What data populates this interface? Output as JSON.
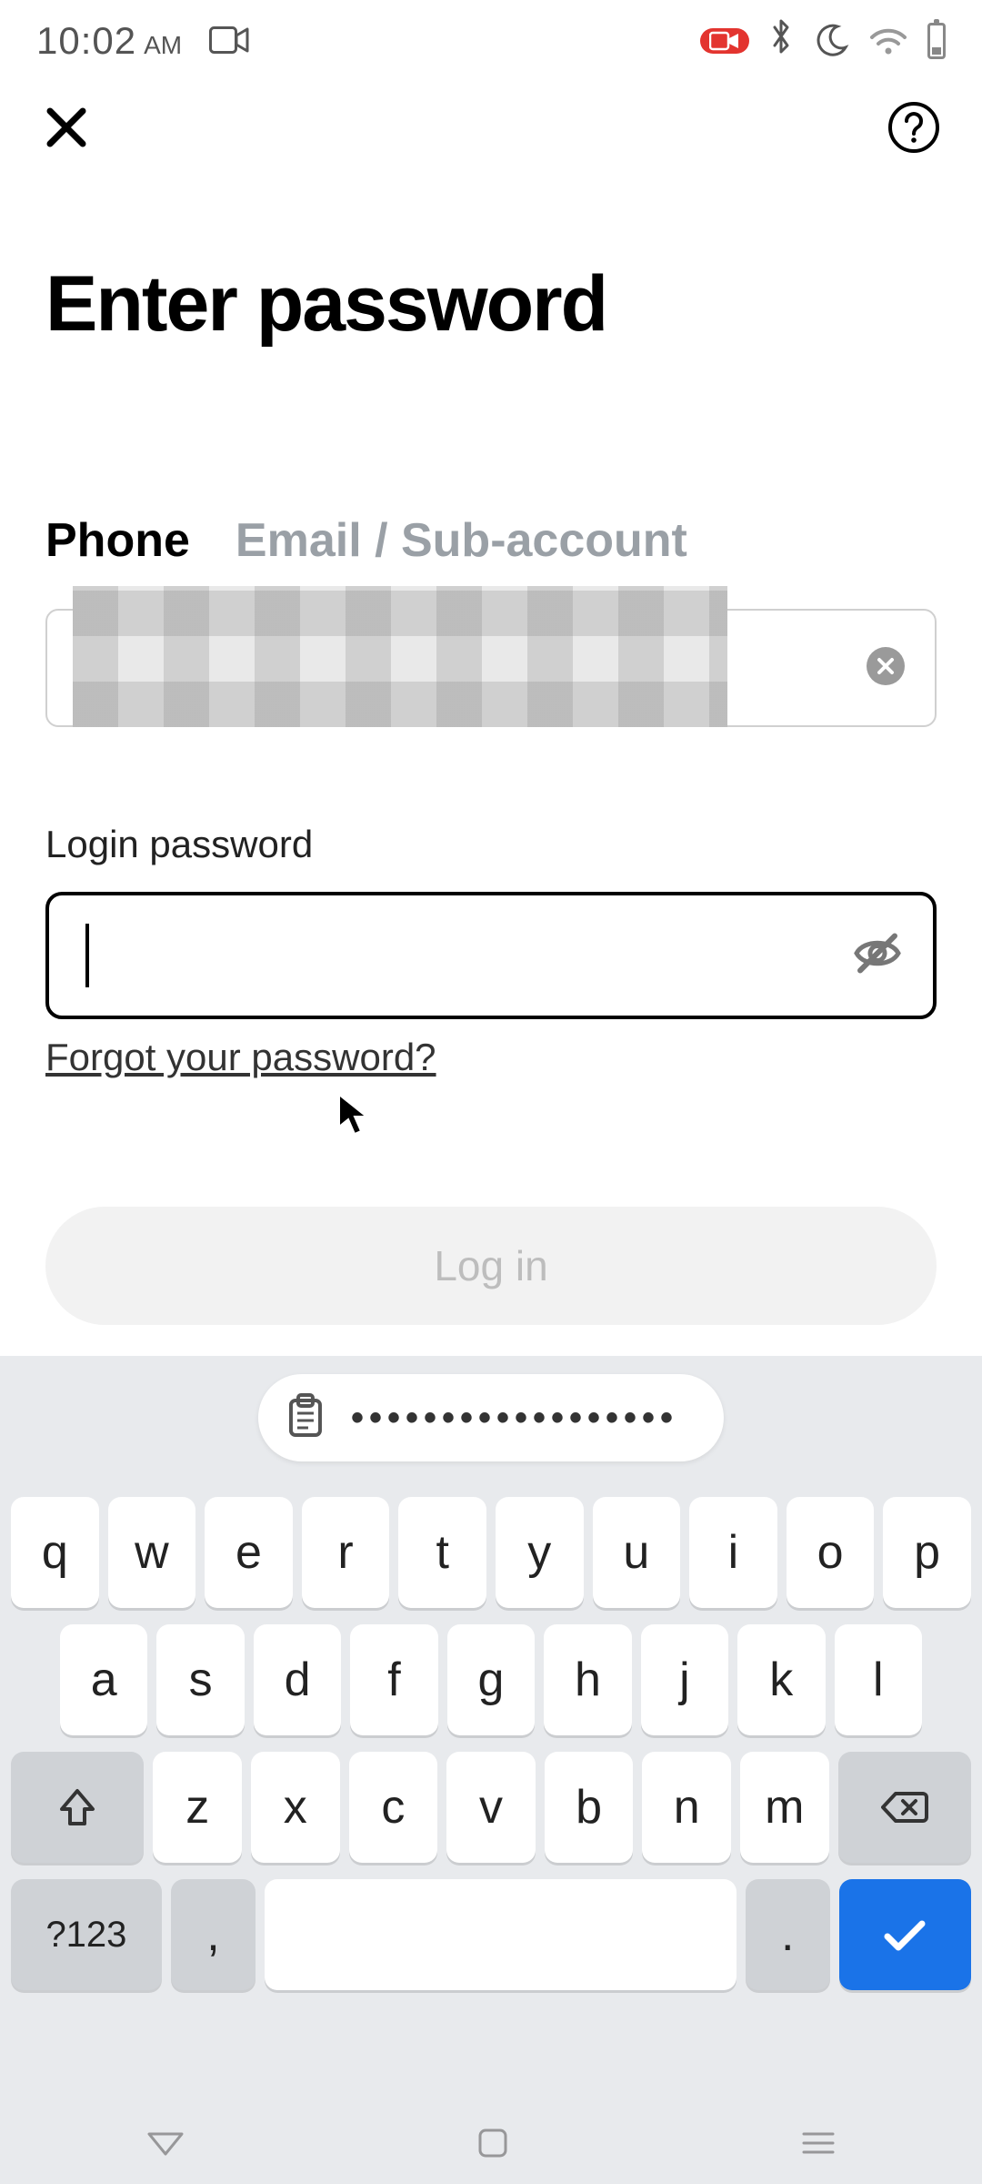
{
  "status": {
    "time": "10:02",
    "am": "AM"
  },
  "page": {
    "title": "Enter password",
    "tab_phone": "Phone",
    "tab_email": "Email / Sub-account",
    "password_label": "Login password",
    "forgot": "Forgot your password?",
    "login": "Log in"
  },
  "suggestion": {
    "dots": "••••••••••••••••••"
  },
  "keyboard": {
    "row1": [
      "q",
      "w",
      "e",
      "r",
      "t",
      "y",
      "u",
      "i",
      "o",
      "p"
    ],
    "row2": [
      "a",
      "s",
      "d",
      "f",
      "g",
      "h",
      "j",
      "k",
      "l"
    ],
    "row3": [
      "z",
      "x",
      "c",
      "v",
      "b",
      "n",
      "m"
    ],
    "sym": "?123",
    "comma": ",",
    "dot": "."
  }
}
